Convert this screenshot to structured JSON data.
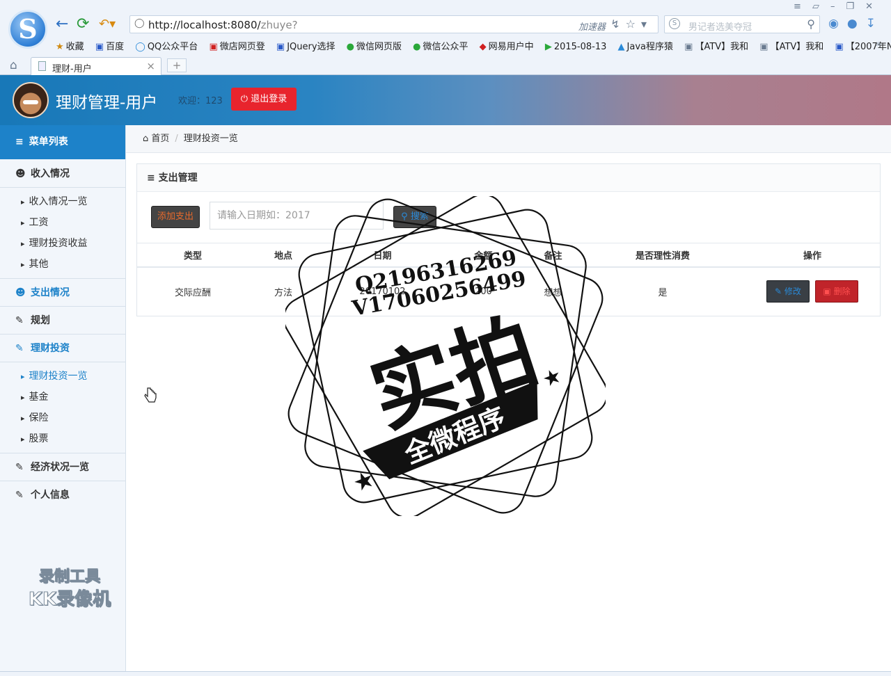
{
  "browser": {
    "logo_letter": "S",
    "url_host": "http://localhost:8080/",
    "url_path": "zhuye?",
    "accelerator": "加速器",
    "search_placeholder": "男记者选美夺冠",
    "bookmarks": [
      "收藏",
      "百度",
      "QQ公众平台",
      "微店网页登",
      "JQuery选择",
      "微信网页版",
      "微信公众平",
      "网易用户中",
      "2015-08-13",
      "Java程序猿",
      "【ATV】我和",
      "【ATV】我和",
      "【2007年N"
    ],
    "tab_title": "理财-用户",
    "new_tab": "+"
  },
  "header": {
    "title": "理财管理-用户",
    "welcome": "欢迎：123",
    "logout_label": "退出登录"
  },
  "sidebar": {
    "head": "菜单列表",
    "sections": [
      {
        "label": "收入情况",
        "icon": "user-icon"
      },
      {
        "label": "支出情况",
        "icon": "user-icon",
        "active": true
      },
      {
        "label": "规划",
        "icon": "edit-icon"
      },
      {
        "label": "理财投资",
        "icon": "edit-icon",
        "active": true
      },
      {
        "label": "经济状况一览",
        "icon": "edit-icon"
      },
      {
        "label": "个人信息",
        "icon": "edit-icon"
      }
    ],
    "income_sub": [
      "收入情况一览",
      "工资",
      "理财投资收益",
      "其他"
    ],
    "invest_sub": [
      "理财投资一览",
      "基金",
      "保险",
      "股票"
    ],
    "recorder_line1": "录制工具",
    "recorder_line2": "KK录像机"
  },
  "breadcrumb": {
    "home": "首页",
    "current": "理财投资一览"
  },
  "panel": {
    "title": "支出管理",
    "add_label": "添加支出",
    "date_placeholder": "请输入日期如：2017",
    "search_label": "搜索",
    "columns": [
      "类型",
      "地点",
      "日期",
      "金额",
      "备注",
      "是否理性消费",
      "操作"
    ],
    "rows": [
      {
        "type": "交际应酬",
        "place": "方法",
        "date": "20170102",
        "amount": "200",
        "note": "想想",
        "rational": "是"
      }
    ],
    "edit_label": "修改",
    "delete_label": "删除"
  },
  "stamp": {
    "line1": "Q2196316269",
    "line2": "V17060256499",
    "big": "实拍",
    "banner": "全微程序"
  },
  "colors": {
    "accent": "#1d82c9",
    "danger": "#e8242d"
  }
}
